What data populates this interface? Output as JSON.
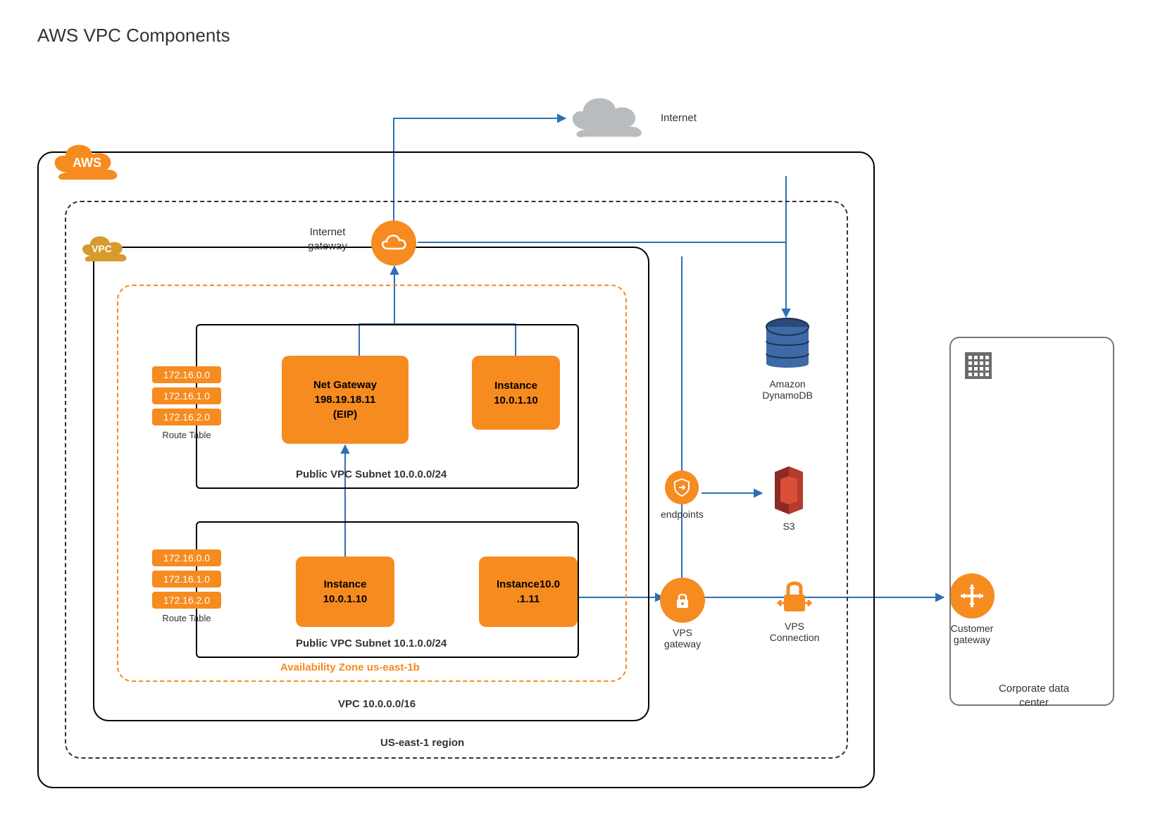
{
  "title": "AWS VPC Components",
  "cloud_label": "AWS",
  "vpc_tag": "VPC",
  "internet_label": "Internet",
  "igw_label": "Internet\ngateway",
  "region_label": "US-east-1 region",
  "vpc_label": "VPC 10.0.0.0/16",
  "az_label": "Availability Zone us-east-1b",
  "subnet1": {
    "label": "Public VPC Subnet 10.0.0.0/24",
    "nat": {
      "l1": "Net Gateway",
      "l2": "198.19.18.11",
      "l3": "(EIP)"
    },
    "inst": {
      "l1": "Instance",
      "l2": "10.0.1.10"
    }
  },
  "subnet2": {
    "label": "Public VPC Subnet 10.1.0.0/24",
    "inst1": {
      "l1": "Instance",
      "l2": "10.0.1.10"
    },
    "inst2": {
      "l1": "Instance10.0",
      "l2": ".1.11"
    }
  },
  "route_table": {
    "caption": "Route Table",
    "rows": [
      "172.16.0.0",
      "172.16.1.0",
      "172.16.2.0"
    ]
  },
  "services": {
    "dynamodb": "Amazon\nDynamoDB",
    "endpoints": "endpoints",
    "s3": "S3",
    "vps_gateway": "VPS gateway",
    "vps_connection": "VPS\nConnection",
    "customer_gateway": "Customer\ngateway"
  },
  "datacenter": "Corporate data center"
}
